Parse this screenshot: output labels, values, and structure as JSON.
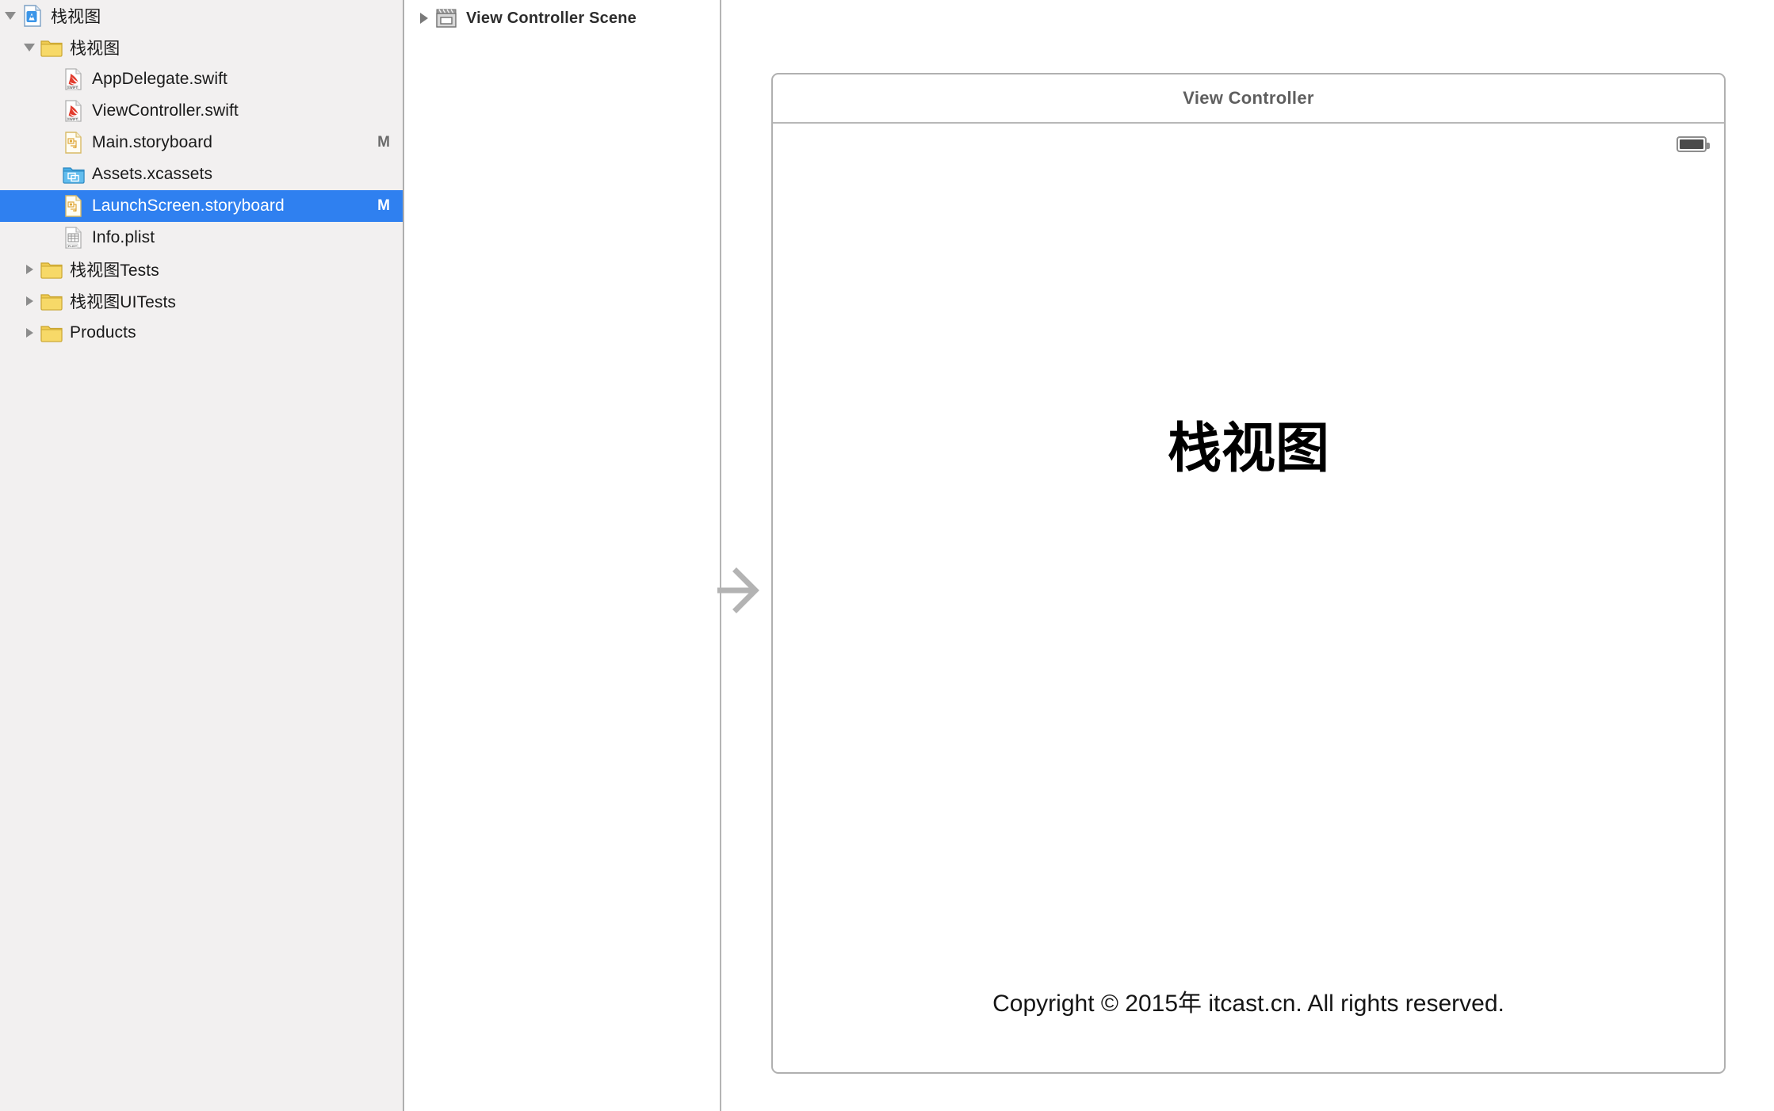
{
  "navigator": {
    "rows": [
      {
        "id": "project-root",
        "label": "栈视图",
        "icon": "xcode-project-icon",
        "indent": 0,
        "twisty": "open",
        "badge": ""
      },
      {
        "id": "group-main",
        "label": "栈视图",
        "icon": "folder-icon",
        "indent": 1,
        "twisty": "open",
        "badge": ""
      },
      {
        "id": "appdelegate-swift",
        "label": "AppDelegate.swift",
        "icon": "swift-file-icon",
        "indent": 2,
        "twisty": "none",
        "badge": ""
      },
      {
        "id": "viewcontroller-swift",
        "label": "ViewController.swift",
        "icon": "swift-file-icon",
        "indent": 2,
        "twisty": "none",
        "badge": ""
      },
      {
        "id": "main-storyboard",
        "label": "Main.storyboard",
        "icon": "storyboard-file-icon",
        "indent": 2,
        "twisty": "none",
        "badge": "M"
      },
      {
        "id": "assets-xcassets",
        "label": "Assets.xcassets",
        "icon": "xcassets-icon",
        "indent": 2,
        "twisty": "none",
        "badge": ""
      },
      {
        "id": "launchscreen-storyboard",
        "label": "LaunchScreen.storyboard",
        "icon": "storyboard-file-icon",
        "indent": 2,
        "twisty": "none",
        "badge": "M",
        "selected": true
      },
      {
        "id": "info-plist",
        "label": "Info.plist",
        "icon": "plist-file-icon",
        "indent": 2,
        "twisty": "none",
        "badge": ""
      },
      {
        "id": "tests-group",
        "label": "栈视图Tests",
        "icon": "folder-icon",
        "indent": 1,
        "twisty": "closed",
        "badge": ""
      },
      {
        "id": "uitests-group",
        "label": "栈视图UITests",
        "icon": "folder-icon",
        "indent": 1,
        "twisty": "closed",
        "badge": ""
      },
      {
        "id": "products-group",
        "label": "Products",
        "icon": "folder-icon",
        "indent": 1,
        "twisty": "closed",
        "badge": ""
      }
    ],
    "selection_color": "#2f80f0"
  },
  "outline": {
    "scene_label": "View Controller Scene",
    "scene_icon": "view-controller-scene-icon",
    "twisty_icon": "disclosure-triangle-right-icon"
  },
  "canvas": {
    "scene_title": "View Controller",
    "entry_arrow_icon": "initial-view-controller-arrow-icon",
    "statusbar": {
      "battery_icon": "battery-icon"
    },
    "big_title": "栈视图",
    "copyright": "Copyright © 2015年 itcast.cn. All rights reserved."
  }
}
